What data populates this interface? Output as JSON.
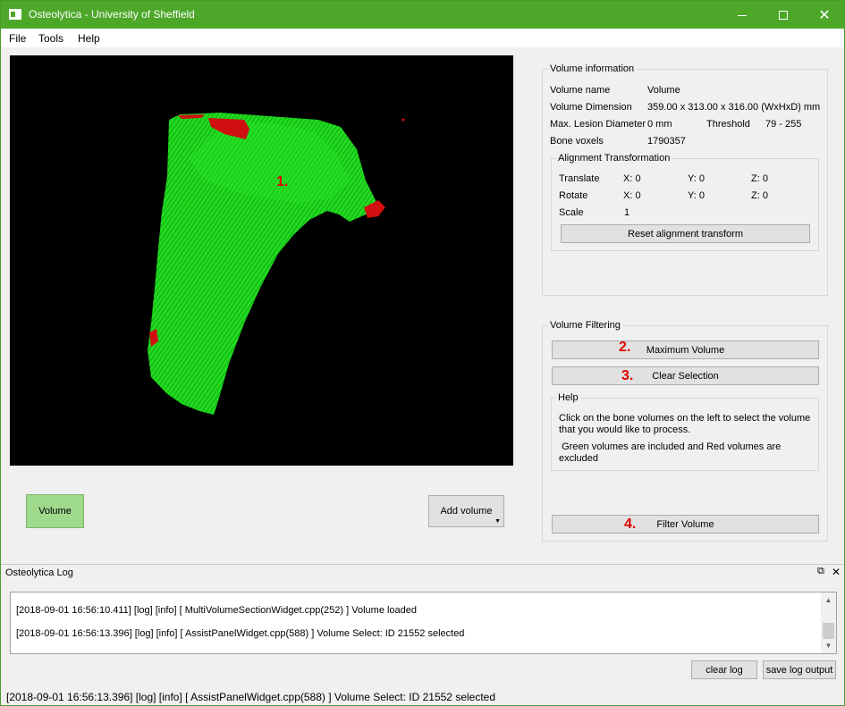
{
  "window": {
    "title": "Osteolytica - University of Sheffield",
    "min_icon": "minimize-icon",
    "max_icon": "maximize-icon",
    "close_icon": "close-icon",
    "close_glyph": "✕"
  },
  "menu": {
    "file": "File",
    "tools": "Tools",
    "help": "Help"
  },
  "viewport": {
    "marker": "1.",
    "bone_color": "#1ed81e",
    "excluded_color": "#d01010"
  },
  "buttons": {
    "volume": "Volume",
    "add_volume": "Add volume",
    "add_volume_caret": "▼"
  },
  "volume_info": {
    "title": "Volume information",
    "name_label": "Volume name",
    "name_value": "Volume",
    "dimension_label": "Volume Dimension",
    "dimension_value": "359.00 x 313.00 x 316.00 (WxHxD) mm",
    "lesion_label": "Max. Lesion Diameter",
    "lesion_value": "0 mm",
    "threshold_label": "Threshold",
    "threshold_value": "79 - 255",
    "voxels_label": "Bone voxels",
    "voxels_value": "1790357"
  },
  "alignment": {
    "title": "Alignment Transformation",
    "translate_label": "Translate",
    "translate": {
      "x": "X: 0",
      "y": "Y: 0",
      "z": "Z: 0"
    },
    "rotate_label": "Rotate",
    "rotate": {
      "x": "X: 0",
      "y": "Y: 0",
      "z": "Z: 0"
    },
    "scale_label": "Scale",
    "scale_value": "1",
    "reset_button": "Reset alignment transform"
  },
  "filtering": {
    "title": "Volume Filtering",
    "max_volume_button": "Maximum Volume",
    "max_volume_marker": "2.",
    "clear_selection_button": "Clear Selection",
    "clear_selection_marker": "3.",
    "help_title": "Help",
    "help_text_1": "Click on the bone volumes on the left to select the volume that you would like to process.",
    "help_text_2": " Green volumes are included and Red volumes are excluded",
    "filter_button": "Filter Volume",
    "filter_marker": "4."
  },
  "log": {
    "title": "Osteolytica Log",
    "float_icon": "float-icon",
    "close_icon": "close-icon",
    "float_glyph": "⧉",
    "close_glyph": "✕",
    "lines": [
      "[2018-09-01 16:56:10.411] [log] [info] [ MultiVolumeSectionWidget.cpp(252) ] Volume loaded",
      "[2018-09-01 16:56:13.396] [log] [info] [ AssistPanelWidget.cpp(588) ] Volume Select: ID 21552 selected"
    ],
    "clear_button": "clear log",
    "save_button": "save log output",
    "scroll_up": "▲",
    "scroll_down": "▼"
  },
  "status": "[2018-09-01 16:56:13.396] [log] [info] [ AssistPanelWidget.cpp(588) ] Volume Select: ID 21552 selected"
}
